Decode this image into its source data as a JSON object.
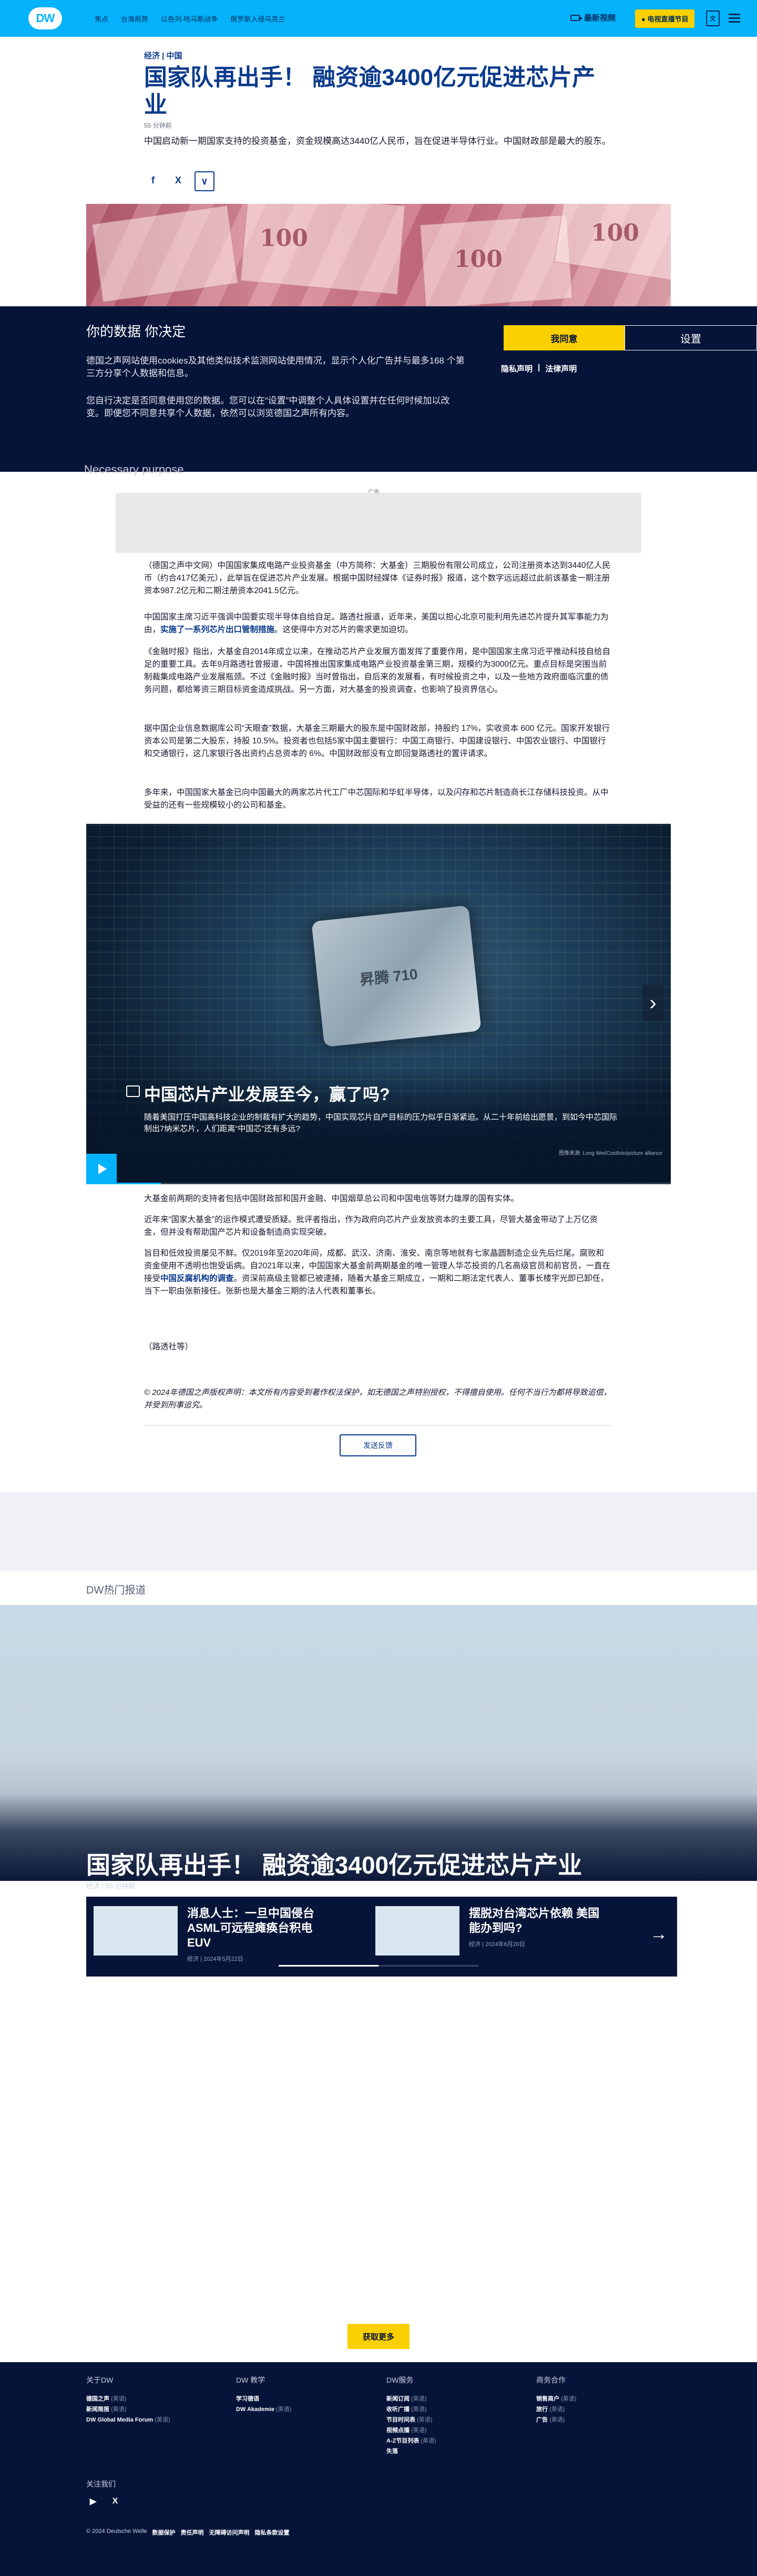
{
  "header": {
    "logo": "DW",
    "nav": [
      "焦点",
      "台海局势",
      "以色列-哈马斯战争",
      "俄罗斯入侵乌克兰"
    ],
    "live_label": "最新视频",
    "onair_label": "电视直播节目",
    "lang_label": "文"
  },
  "article": {
    "kicker": "经济 | 中国",
    "title": "国家队再出手！ 融资逾3400亿元促进芯片产业",
    "meta": "55 分钟前",
    "teaser": "中国启动新一期国家支持的投资基金，资金规模高达3440亿人民币，旨在促进半导体行业。中国财政部是最大的股东。",
    "share": [
      "f",
      "X",
      "∨"
    ]
  },
  "cookie": {
    "heading": "你的数据 你决定",
    "p1": "德国之声网站使用cookies及其他类似技术监测网站使用情况，显示个人化广告并与最多168 个第三方分享个人数据和信息。",
    "p2": "您自行决定是否同意使用您的数据。您可以在“设置”中调整个人具体设置并在任何时候加以改变。即便您不同意共享个人数据，依然可以浏览德国之声所有内容。",
    "accept": "我同意",
    "settings": "设置",
    "links": [
      "隐私声明",
      "|",
      "法律声明"
    ],
    "necessary": "Necessary purpose"
  },
  "ad": {
    "label": "广告"
  },
  "body": {
    "p1": "（德国之声中文网）中国国家集成电路产业投资基金（中方简称：大基金）三期股份有限公司成立，公司注册资本达到3440亿人民币（约合417亿美元），此举旨在促进芯片产业发展。根据中国财经媒体《证券时报》报道，这个数字远远超过此前该基金一期注册资本987.2亿元和二期注册资本2041.5亿元。",
    "p2_pre": "中国国家主席习近平强调中国要实现半导体自给自足。路透社报道，近年来，美国以担心北京可能利用先进芯片提升其军事能力为由，",
    "p2_link": "实施了一系列芯片出口管制措施",
    "p2_post": "。这使得中方对芯片的需求更加迫切。",
    "p3": "《金融时报》指出，大基金自2014年成立以来，在推动芯片产业发展方面发挥了重要作用，是中国国家主席习近平推动科技自给自足的重要工具。去年9月路透社曾报道，中国将推出国家集成电路产业投资基金第三期，规模约为3000亿元。重点目标是突围当前制裁集成电路产业发展瓶颈。不过《金融时报》当时曾指出，自后来的发展看，有时候投资之中，以及一些地方政府面临沉重的债务问题，都给筹资三期目标资金造成挑战。另一方面，对大基金的投资调查，也影响了投资界信心。",
    "p4": "据中国企业信息数据库公司“天眼查”数据，大基金三期最大的股东是中国财政部，持股约 17%，实收资本 600 亿元。国家开发银行资本公司是第二大股东，持股 10.5%。投资者也包括5家中国主要银行：中国工商银行、中国建设银行、中国农业银行、中国银行和交通银行，这几家银行各出资约占总资本的 6%。中国财政部没有立即回复路透社的置评请求。",
    "p5": "多年来，中国国家大基金已向中国最大的两家芯片代工厂中芯国际和华虹半导体，以及闪存和芯片制造商长江存储科技投资。从中受益的还有一些规模较小的公司和基金。",
    "p6": "大基金前两期的支持者包括中国财政部和国开金融、中国烟草总公司和中国电信等财力雄厚的国有实体。",
    "p7": "近年来“国家大基金”的运作模式遭受质疑。批评者指出，作为政府向芯片产业发放资本的主要工具，尽管大基金带动了上万亿资金，但并没有帮助国产芯片和设备制造商实现突破。",
    "p8_pre": "旨目和低效投资屡见不鲜。仅2019年至2020年间，成都、武汉、济南、淮安、南京等地就有七家晶圆制造企业先后烂尾。腐败和资金使用不透明也饱受诟病。自2021年以来，中国国家大基金前两期基金的唯一管理人华芯投资的几名高级官员和前官员，一直在接受",
    "p8_link": "中国反腐机构的调查",
    "p8_post": "。资深前高级主管都已被逮捕，随着大基金三期成立，一期和二期法定代表人、董事长楼宇光即已卸任，当下一职由张新接任。张新也是大基金三期的法人代表和董事长。",
    "sign": "（路透社等）",
    "copyright": "© 2024年德国之声版权声明：本文所有内容受到著作权法保护，如无德国之声特别授权，不得擅自使用。任何不当行为都将导致追偿，并受到刑事追究。",
    "feedback": "发送反馈"
  },
  "gallery": {
    "title": "中国芯片产业发展至今，赢了吗?",
    "desc": "随着美国打压中国高科技企业的制裁有扩大的趋势，中国实现芯片自产目标的压力似乎日渐紧迫。从二十年前给出愿景，到如今中芯国际制出7纳米芯片，人们距离“中国芯”还有多远?",
    "chip_label": "昇腾 710",
    "credit": "图像来源: Long Wei/Costfoto/picture alliance",
    "next": "›"
  },
  "popular": {
    "label": "DW热门报道",
    "hero_title": "国家队再出手！ 融资逾3400亿元促进芯片产业",
    "hero_meta": "经济 | 55 分钟前",
    "cards": [
      {
        "title": "消息人士：一旦中国侵台 ASML可远程瘫痪台积电EUV",
        "meta": "经济 | 2024年5月22日"
      },
      {
        "title": "摆脱对台湾芯片依赖 美国能办到吗?",
        "meta": "经济 | 2024年6月20日"
      }
    ],
    "arrow": "→",
    "more_button": "获取更多"
  },
  "footer": {
    "cols": [
      {
        "heading": "关于DW",
        "items": [
          {
            "t": "德国之声",
            "s": "(英语)"
          },
          {
            "t": "新闻简报",
            "s": "(英语)"
          },
          {
            "t": "DW Global Media Forum",
            "s": "(英语)"
          }
        ]
      },
      {
        "heading": "DW 教学",
        "items": [
          {
            "t": "学习德语",
            "s": ""
          },
          {
            "t": "DW Akademie",
            "s": "(英语)"
          }
        ]
      },
      {
        "heading": "DW服务",
        "items": [
          {
            "t": "新闻订阅",
            "s": "(英语)"
          },
          {
            "t": "收听广播",
            "s": "(英语)"
          },
          {
            "t": "节目时间表",
            "s": "(英语)"
          },
          {
            "t": "视频点播",
            "s": "(英语)"
          },
          {
            "t": "A-Z节目列表",
            "s": "(英语)"
          },
          {
            "t": "失落",
            "s": ""
          }
        ]
      },
      {
        "heading": "商务合作",
        "items": [
          {
            "t": "销售商户",
            "s": "(英语)"
          },
          {
            "t": "旅行",
            "s": "(英语)"
          },
          {
            "t": "广告",
            "s": "(英语)"
          }
        ]
      }
    ],
    "follow": "关注我们",
    "social": [
      "▶",
      "X"
    ],
    "bottom": [
      "© 2024 Deutsche Welle",
      "数据保护",
      "责任声明",
      "无障碍访问声明",
      "隐私条款设置"
    ]
  }
}
